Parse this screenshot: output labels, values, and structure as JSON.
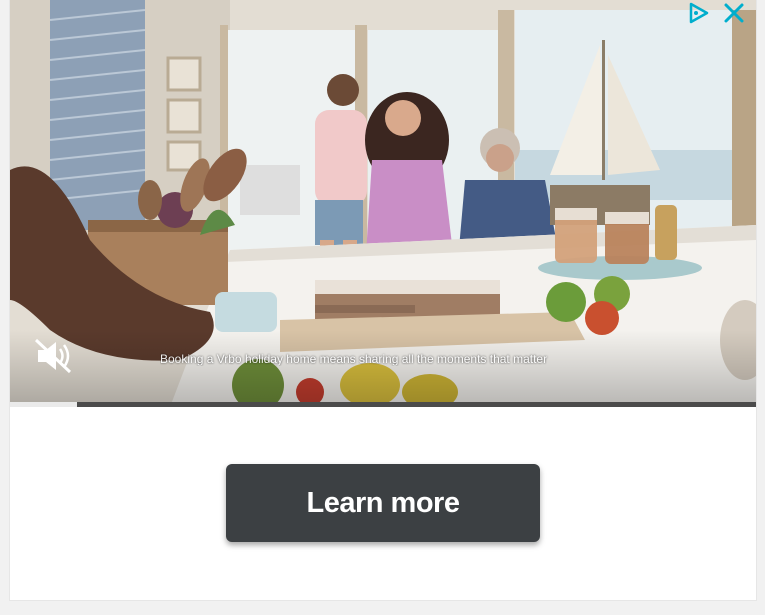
{
  "video": {
    "caption": "Booking a Vrbo holiday home means sharing all the moments that matter",
    "muted": true,
    "progress_fraction": 0.09
  },
  "controls": {
    "mute_icon": "speaker-muted-icon",
    "adchoices_icon": "adchoices-icon",
    "close_icon": "close-icon"
  },
  "cta": {
    "label": "Learn more"
  },
  "colors": {
    "cta_background": "#3c4043",
    "adchoices_blue": "#00aecd"
  }
}
